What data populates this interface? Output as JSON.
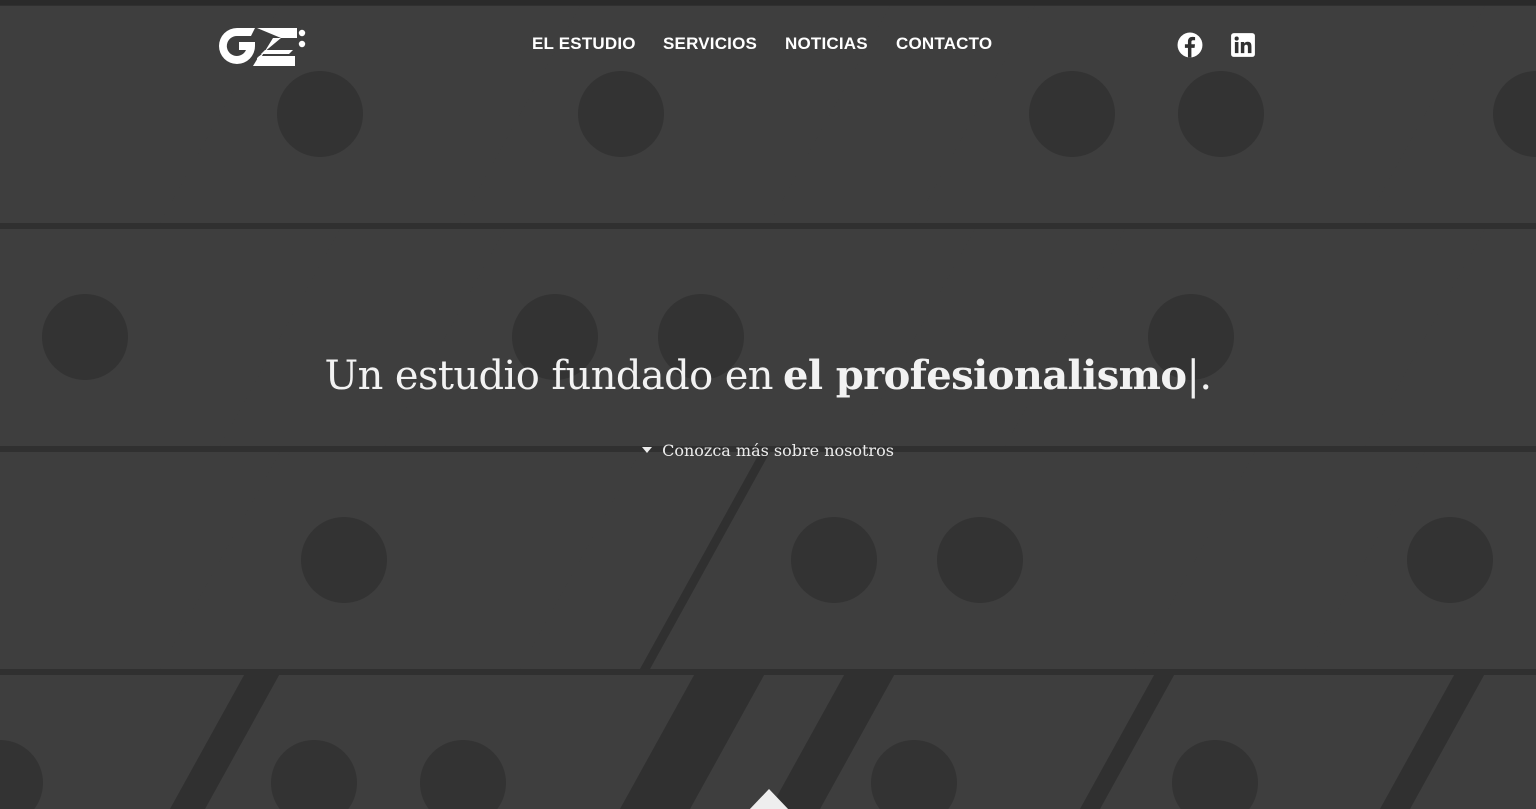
{
  "brand": {
    "logo_text": "GZ"
  },
  "nav": {
    "items": [
      {
        "label": "EL ESTUDIO"
      },
      {
        "label": "SERVICIOS"
      },
      {
        "label": "NOTICIAS"
      },
      {
        "label": "CONTACTO"
      }
    ]
  },
  "social": {
    "icons": [
      "facebook-icon",
      "linkedin-icon"
    ]
  },
  "hero": {
    "headline_prefix": "Un estudio fundado en",
    "headline_emphasis": "el profesionalismo",
    "headline_caret": "|",
    "headline_suffix": ".",
    "more_link": "Conozca más sobre nosotros"
  },
  "colors": {
    "background": "#303030",
    "pattern_shape": "#3e3e3e",
    "pattern_dot": "#333333",
    "text": "#ffffff"
  }
}
